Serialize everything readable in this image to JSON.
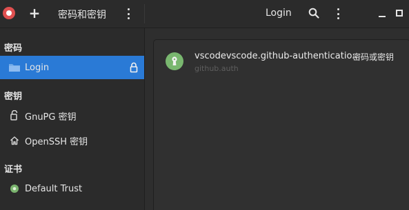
{
  "header": {
    "left_title": "密码和密钥",
    "right_title": "Login",
    "add_label": "+"
  },
  "sidebar": {
    "section_passwords": "密码",
    "section_keys": "密钥",
    "section_certs": "证书",
    "items": [
      {
        "label": "Login"
      },
      {
        "label": "GnuPG 密钥"
      },
      {
        "label": "OpenSSH 密钥"
      },
      {
        "label": "Default Trust"
      }
    ]
  },
  "content": {
    "entries": [
      {
        "title": "vscodevscode.github-authenticatio...",
        "type": "密码或密钥",
        "subtitle": "github.auth"
      }
    ]
  },
  "colors": {
    "accent": "#2a7ad6",
    "app_icon": "#e05050",
    "entry_icon": "#79b76f"
  }
}
